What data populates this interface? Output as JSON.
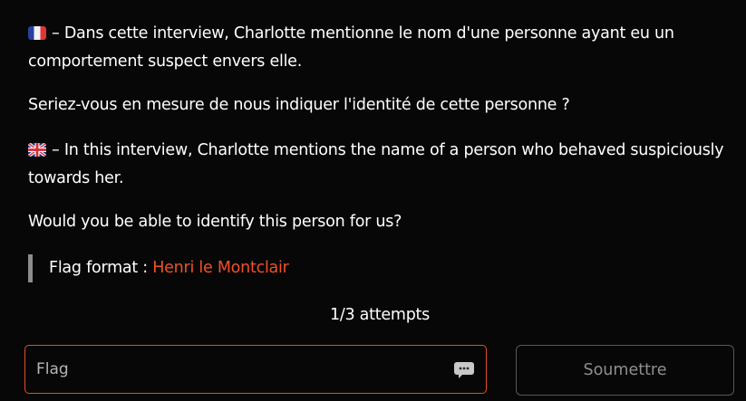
{
  "description": {
    "fr_line1": "– Dans cette interview, Charlotte mentionne le nom d'une personne ayant eu un",
    "fr_line2": "comportement suspect envers elle.",
    "fr_question": "Seriez-vous en mesure de nous indiquer l'identité de cette personne ?",
    "en_line1": "– In this interview, Charlotte mentions the name of a person who behaved suspiciously",
    "en_line2": "towards her.",
    "en_question": "Would you be able to identify this person for us?"
  },
  "flag_format": {
    "label": "Flag format : ",
    "example": "Henri le Montclair"
  },
  "attempts": "1/3 attempts",
  "form": {
    "flag_placeholder": "Flag",
    "flag_value": "",
    "submit_label": "Soumettre"
  },
  "icons": {
    "french_flag": "flag-fr-icon",
    "uk_flag": "flag-uk-icon",
    "password_manager": "password-dots-icon"
  },
  "colors": {
    "background": "#070707",
    "accent": "#f0512a",
    "input_border": "#e04e2a",
    "button_border": "#585858"
  }
}
